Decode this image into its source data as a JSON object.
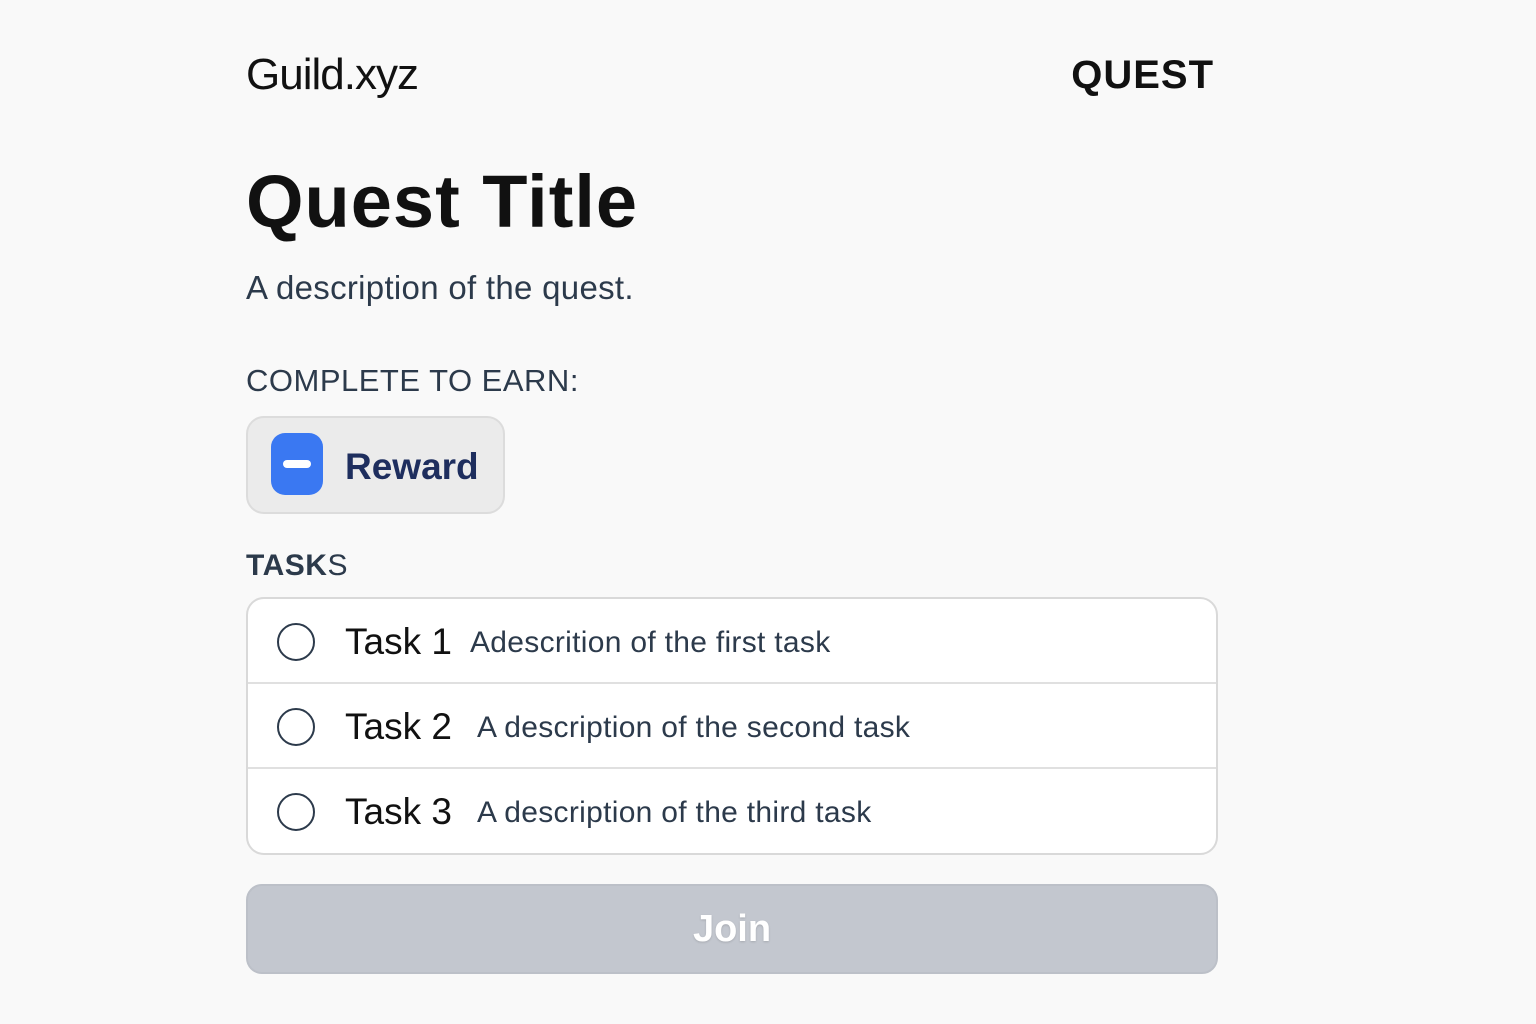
{
  "header": {
    "brand": "Guild.xyz",
    "tag": "QUEST"
  },
  "quest": {
    "title": "Quest Title",
    "description": "A description of the quest."
  },
  "reward": {
    "section_label": "COMPLETE TO EARN:",
    "label": "Reward",
    "icon": "minus-badge-icon",
    "icon_color": "#3a78f2"
  },
  "tasks": {
    "section_label_bold": "TASK",
    "section_label_rest": "S",
    "items": [
      {
        "name": "Task 1",
        "description": "Adescrition of the first task",
        "completed": false
      },
      {
        "name": "Task 2",
        "description": "A description of the second task",
        "completed": false
      },
      {
        "name": "Task 3",
        "description": "A description of the third task",
        "completed": false
      }
    ]
  },
  "join_button": {
    "label": "Join",
    "state": "disabled",
    "color": "#c3c7cf"
  }
}
